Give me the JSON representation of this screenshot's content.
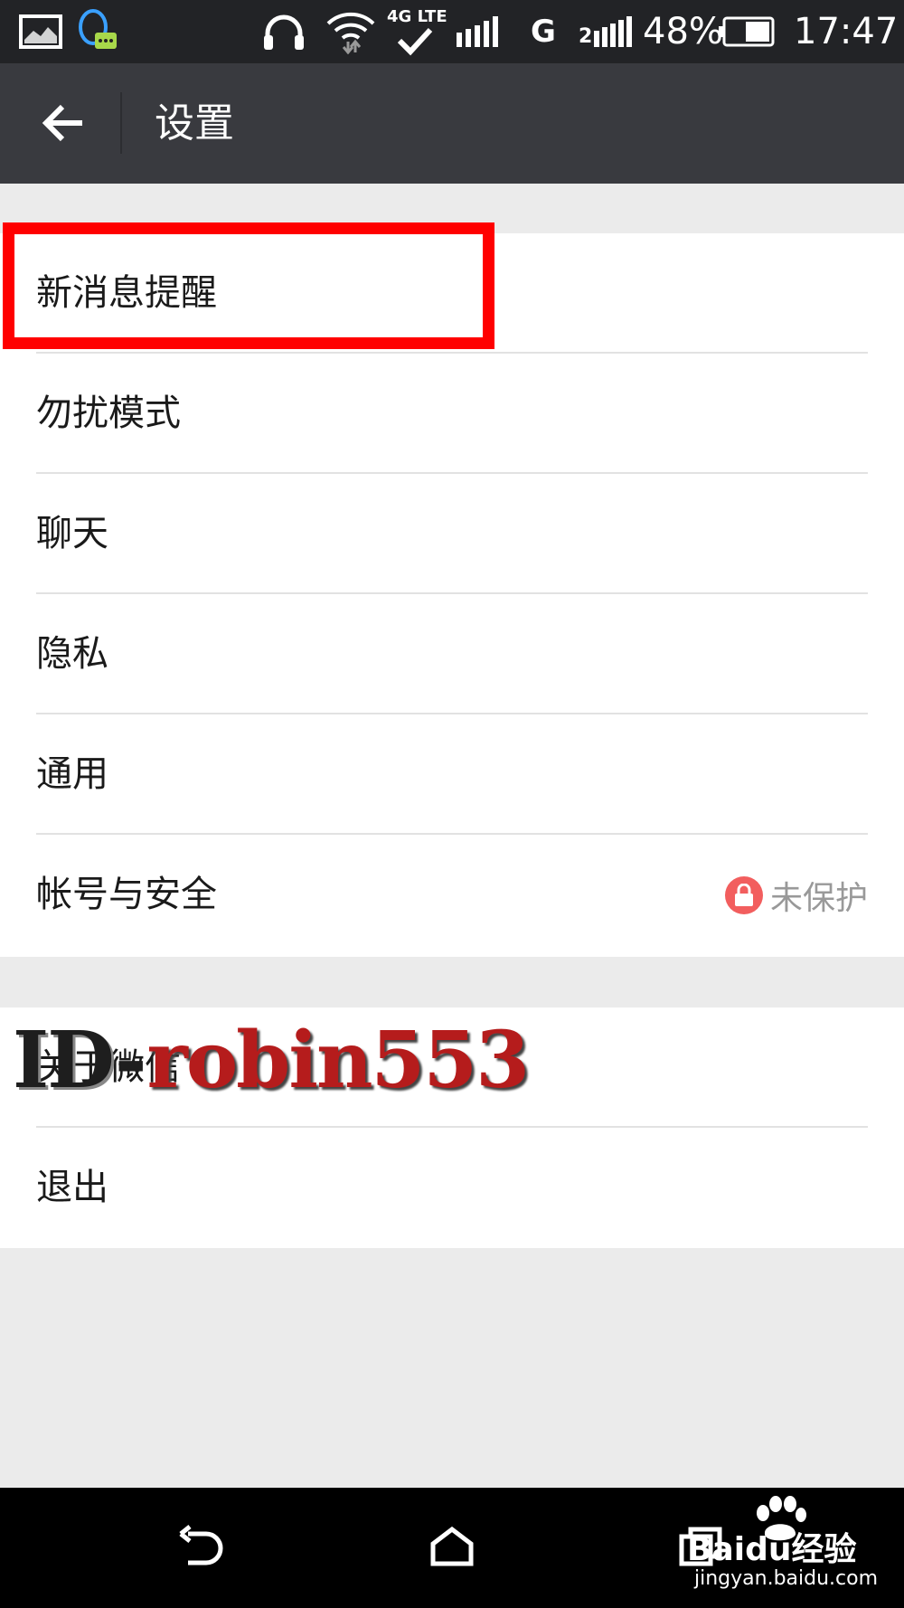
{
  "status_bar": {
    "network_label": "4G LTE",
    "carrier2_label": "G",
    "sim2_label": "2",
    "battery": "48%",
    "time": "17:47",
    "icons": [
      "gallery-icon",
      "qq-icon",
      "headphones-icon",
      "wifi-icon",
      "signal-icon",
      "battery-icon"
    ]
  },
  "app_bar": {
    "title": "设置",
    "back_icon": "arrow-left-icon"
  },
  "settings_group1": [
    {
      "label": "新消息提醒"
    },
    {
      "label": "勿扰模式"
    },
    {
      "label": "聊天"
    },
    {
      "label": "隐私"
    },
    {
      "label": "通用"
    },
    {
      "label": "帐号与安全",
      "status": "未保护",
      "status_icon": "lock-icon"
    }
  ],
  "settings_group2": [
    {
      "label": "关于微信"
    },
    {
      "label": "退出"
    }
  ],
  "watermark": {
    "prefix": "ID",
    "dash": "-",
    "name": "robin553"
  },
  "nav_bar": {
    "icons": [
      "back-nav-icon",
      "home-nav-icon",
      "recents-nav-icon"
    ],
    "logo_text": "Baidu经验",
    "logo_url": "jingyan.baidu.com"
  },
  "colors": {
    "status_bar_bg": "#222326",
    "app_bar_bg": "#393a3f",
    "page_bg": "#ebebeb",
    "highlight": "#ff0000",
    "lock_badge": "#f25e5e"
  }
}
